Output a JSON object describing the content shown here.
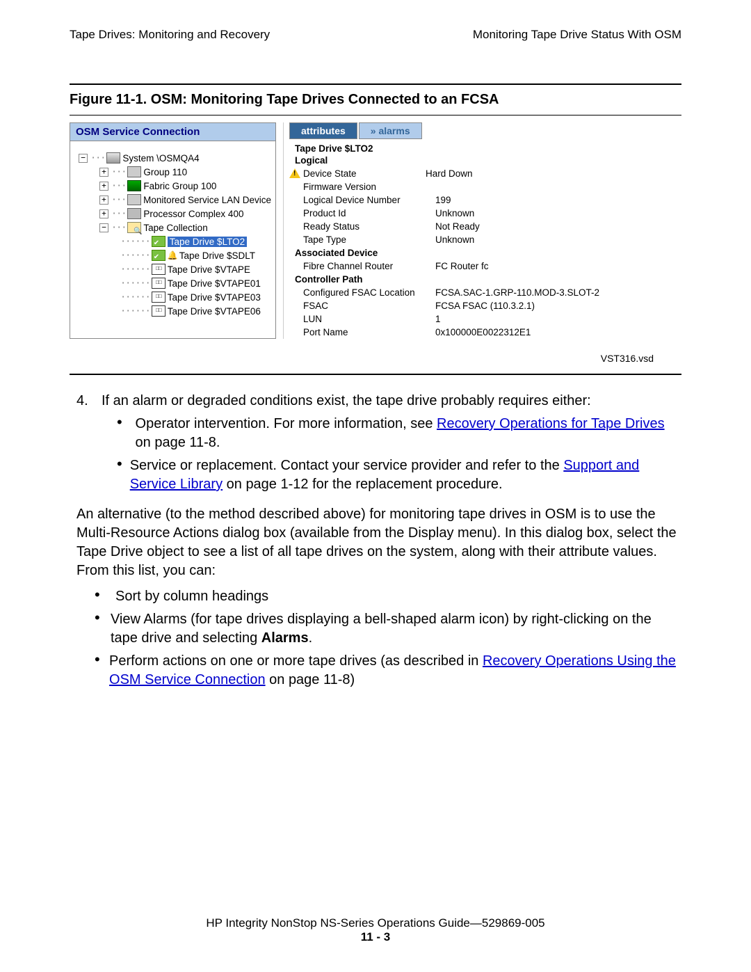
{
  "header": {
    "left": "Tape Drives: Monitoring and Recovery",
    "right": "Monitoring Tape Drive Status With OSM"
  },
  "figure": {
    "label": "Figure 11-1.  OSM: Monitoring Tape Drives Connected to an FCSA",
    "vst": "VST316.vsd"
  },
  "osm": {
    "title": "OSM Service Connection",
    "tree": {
      "system": "System \\OSMQA4",
      "group": "Group 110",
      "fabric": "Fabric Group 100",
      "lan": "Monitored Service LAN Device",
      "proc": "Processor Complex 400",
      "collection": "Tape Collection",
      "drives": [
        "Tape Drive $LTO2",
        "Tape Drive $SDLT",
        "Tape Drive $VTAPE",
        "Tape Drive $VTAPE01",
        "Tape Drive $VTAPE03",
        "Tape Drive $VTAPE06"
      ]
    },
    "tabs": {
      "active": "attributes",
      "inactive": "» alarms"
    },
    "attrs": {
      "title": "Tape Drive $LTO2",
      "section_logical": "Logical",
      "device_state_l": "Device State",
      "device_state_v": "Hard Down",
      "fw_l": "Firmware Version",
      "fw_v": "",
      "ldn_l": "Logical Device Number",
      "ldn_v": "199",
      "pid_l": "Product Id",
      "pid_v": "Unknown",
      "ready_l": "Ready Status",
      "ready_v": "Not Ready",
      "tape_l": "Tape Type",
      "tape_v": "Unknown",
      "section_assoc": "Associated Device",
      "fcr_l": "Fibre Channel Router",
      "fcr_v": "FC Router fc",
      "section_ctrl": "Controller Path",
      "cfg_l": "Configured FSAC Location",
      "cfg_v": "FCSA.SAC-1.GRP-110.MOD-3.SLOT-2",
      "fsac_l": "FSAC",
      "fsac_v": "FCSA FSAC (110.3.2.1)",
      "lun_l": "LUN",
      "lun_v": "1",
      "port_l": "Port Name",
      "port_v": "0x100000E0022312E1"
    }
  },
  "body": {
    "item4_num": "4.",
    "item4_text": "If an alarm or degraded conditions exist, the tape drive probably requires either:",
    "b1_pre": "Operator intervention. For more information, see ",
    "b1_link": "Recovery Operations for Tape Drives",
    "b1_post": " on page 11-8.",
    "b2_pre": "Service or replacement. Contact your service provider and refer to the ",
    "b2_link": "Support and Service Library",
    "b2_post": " on page 1-12 for the replacement procedure.",
    "para": "An alternative (to the method described above) for monitoring tape drives in OSM is to use the Multi-Resource Actions dialog box (available from the Display menu). In this dialog box, select the Tape Drive object to see a list of all tape drives on the system, along with their attribute values. From this list, you can:",
    "c1": "Sort by column headings",
    "c2a": "View Alarms (for tape drives displaying a bell-shaped alarm icon) by right-clicking on the tape drive and selecting ",
    "c2b": "Alarms",
    "c2c": ".",
    "c3a": "Perform actions on one or more tape drives (as described in ",
    "c3link": "Recovery Operations Using the OSM Service Connection",
    "c3b": " on page 11-8)"
  },
  "footer": {
    "line": "HP Integrity NonStop NS-Series Operations Guide—529869-005",
    "page": "11 - 3"
  }
}
